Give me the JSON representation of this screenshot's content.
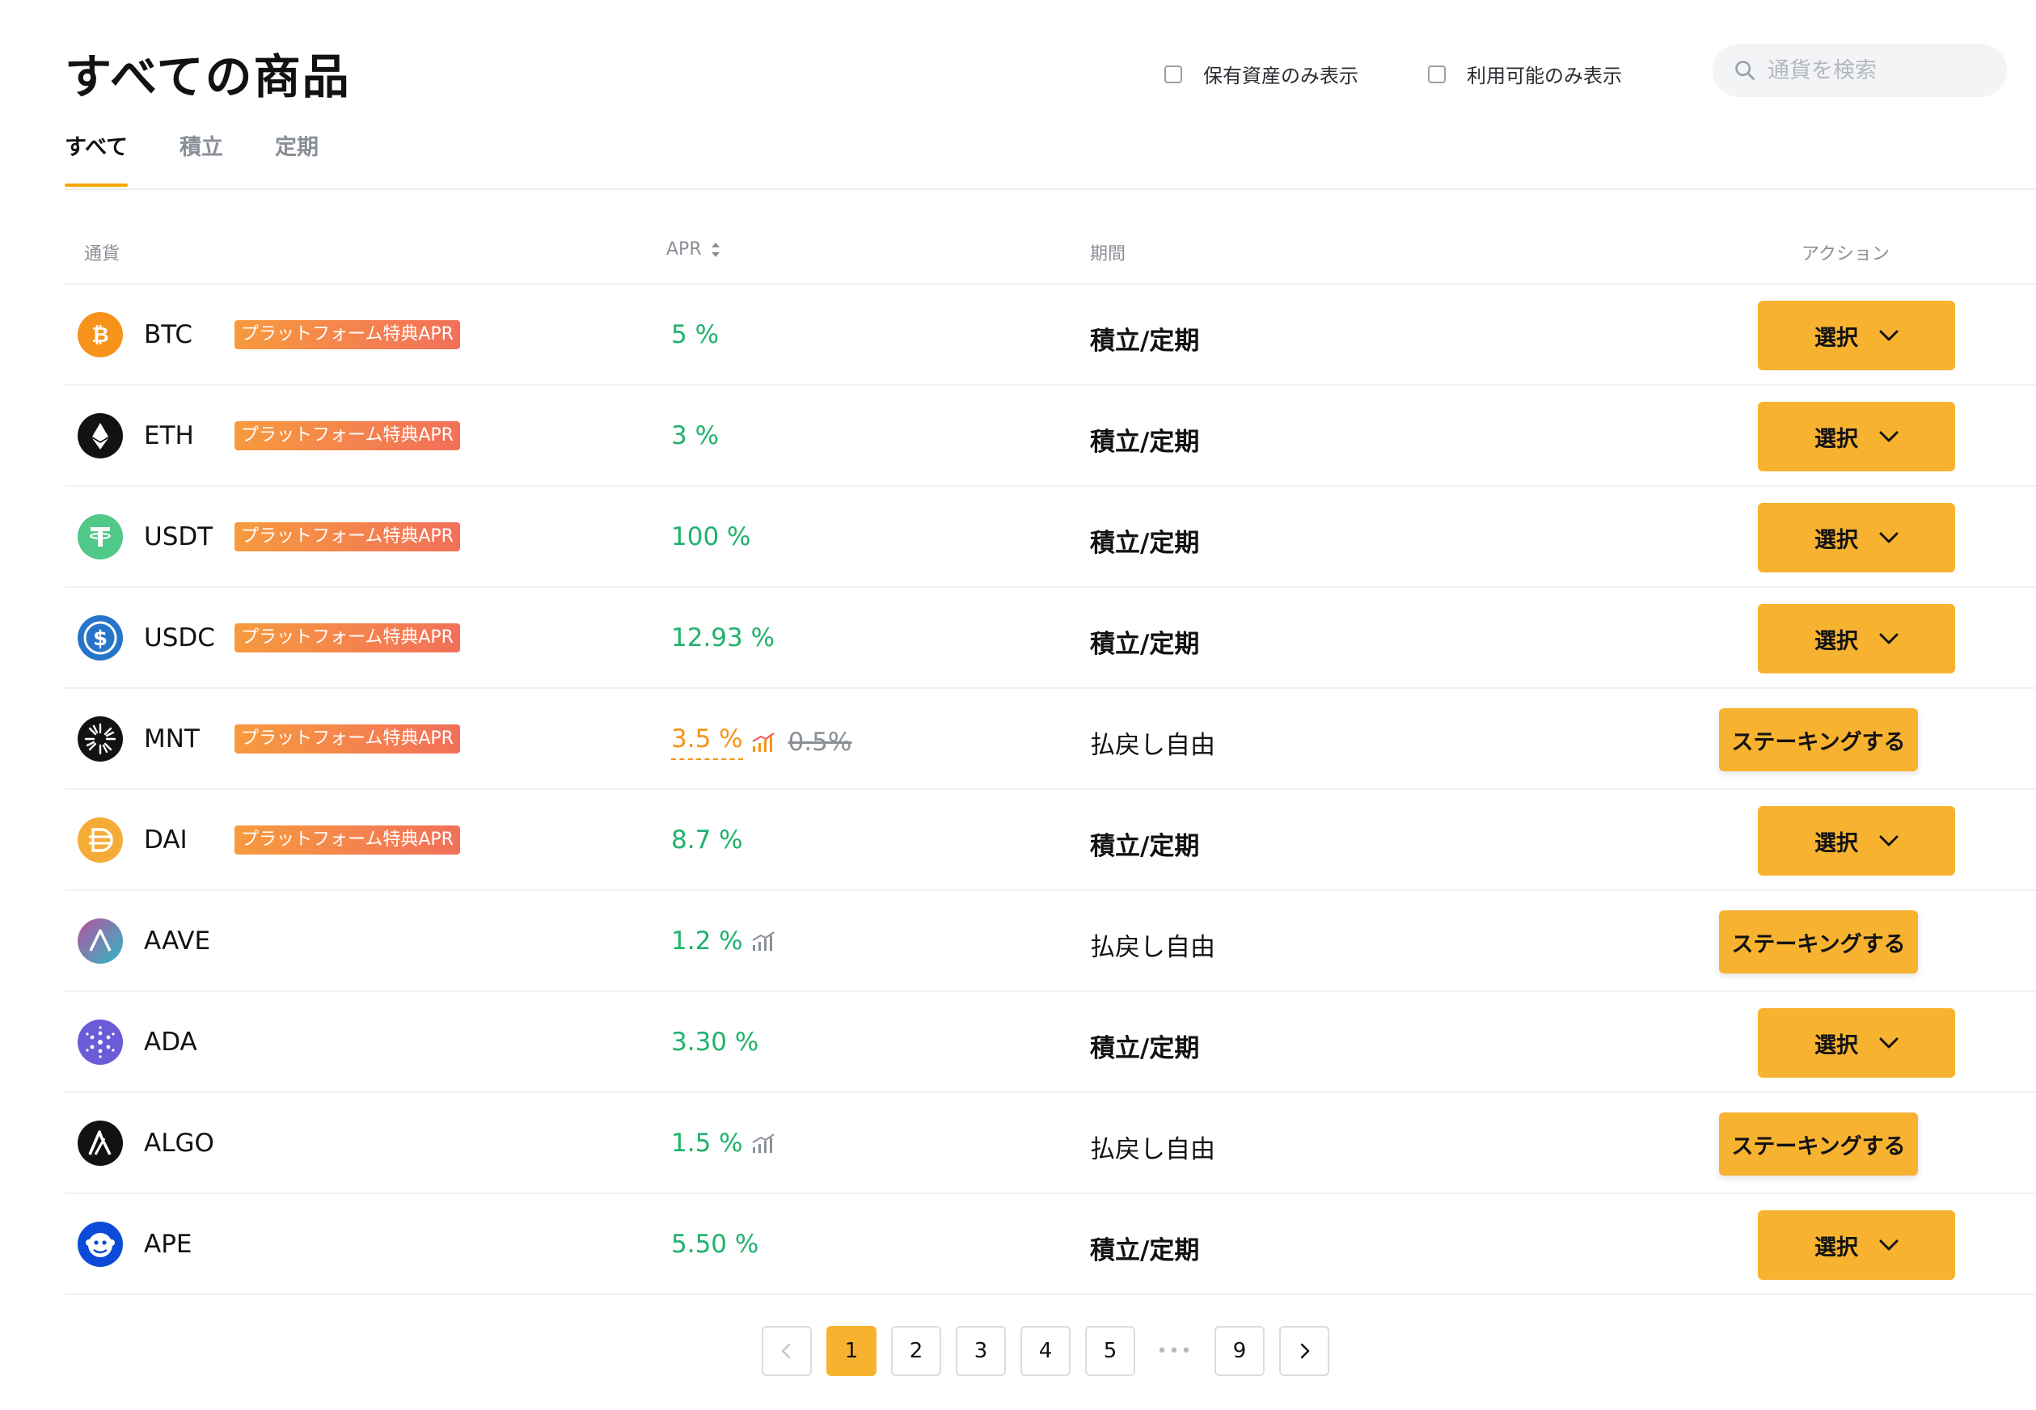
{
  "page_title": "すべての商品",
  "filters": {
    "held_only": "保有資産のみ表示",
    "available_only": "利用可能のみ表示"
  },
  "search": {
    "placeholder": "通貨を検索"
  },
  "tabs": [
    "すべて",
    "積立",
    "定期"
  ],
  "columns": {
    "currency": "通貨",
    "apr": "APR",
    "period": "期間",
    "action": "アクション"
  },
  "badge_text": "プラットフォーム特典APR",
  "labels": {
    "select": "選択",
    "stake": "ステーキングする"
  },
  "rows": [
    {
      "symbol": "BTC",
      "apr": "5 %",
      "period": "積立/定期",
      "action": "select"
    },
    {
      "symbol": "ETH",
      "apr": "3 %",
      "period": "積立/定期",
      "action": "select"
    },
    {
      "symbol": "USDT",
      "apr": "100 %",
      "period": "積立/定期",
      "action": "select"
    },
    {
      "symbol": "USDC",
      "apr": "12.93 %",
      "period": "積立/定期",
      "action": "select"
    },
    {
      "symbol": "MNT",
      "apr": "3.5 %",
      "apr_old": "0.5%",
      "period": "払戻し自由",
      "action": "stake"
    },
    {
      "symbol": "DAI",
      "apr": "8.7 %",
      "period": "積立/定期",
      "action": "select"
    },
    {
      "symbol": "AAVE",
      "apr": "1.2 %",
      "period": "払戻し自由",
      "action": "stake"
    },
    {
      "symbol": "ADA",
      "apr": "3.30 %",
      "period": "積立/定期",
      "action": "select"
    },
    {
      "symbol": "ALGO",
      "apr": "1.5 %",
      "period": "払戻し自由",
      "action": "stake"
    },
    {
      "symbol": "APE",
      "apr": "5.50 %",
      "period": "積立/定期",
      "action": "select"
    }
  ],
  "pagination": {
    "pages": [
      "1",
      "2",
      "3",
      "4",
      "5"
    ],
    "ellipsis": "•••",
    "last": "9",
    "current": "1"
  },
  "colors": {
    "accent": "#f7b230",
    "apr_green": "#20b26c",
    "promo_orange": "#f7931a"
  }
}
